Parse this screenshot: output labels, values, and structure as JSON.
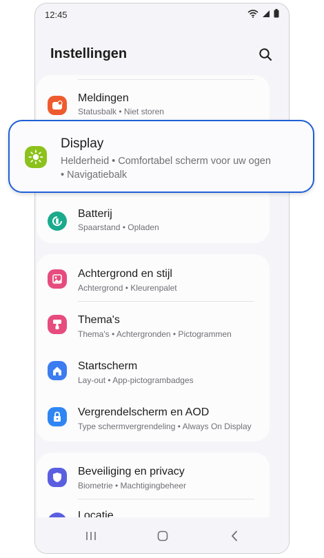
{
  "status": {
    "time": "12:45"
  },
  "header": {
    "title": "Instellingen"
  },
  "group1": [
    {
      "title": "Meldingen",
      "sub": "Statusbalk  •  Niet storen",
      "icon": "bell-icon",
      "color": "#ee5b2f"
    },
    {
      "title": "Display",
      "sub1": "Helderheid  •  Comfortabel scherm voor uw ogen",
      "sub2": "•  Navigatiebalk",
      "icon": "brightness-icon",
      "color": "#8cc21b"
    },
    {
      "title": "Batterij",
      "sub": "Spaarstand  •  Opladen",
      "icon": "battery-icon",
      "color": "#1aab8c"
    }
  ],
  "group2": [
    {
      "title": "Achtergrond en stijl",
      "sub": "Achtergrond  •  Kleurenpalet",
      "icon": "wallpaper-icon",
      "color": "#e64c7e"
    },
    {
      "title": "Thema's",
      "sub": "Thema's  •  Achtergronden  •  Pictogrammen",
      "icon": "theme-brush-icon",
      "color": "#e64c7e"
    },
    {
      "title": "Startscherm",
      "sub": "Lay-out  •  App-pictogrambadges",
      "icon": "home-icon",
      "color": "#3c7cf1"
    },
    {
      "title": "Vergrendelscherm en AOD",
      "sub": "Type schermvergrendeling  •  Always On Display",
      "icon": "lock-icon",
      "color": "#2f86f2"
    }
  ],
  "group3": [
    {
      "title": "Beveiliging en privacy",
      "sub": "Biometrie  •  Machtigingbeheer",
      "icon": "shield-icon",
      "color": "#5a5fe0"
    },
    {
      "title": "Locatie",
      "sub": "",
      "icon": "location-icon",
      "color": "#5a5fe0"
    }
  ],
  "nav": {
    "recents": "recent-apps-icon",
    "home": "home-button-icon",
    "back": "back-icon"
  }
}
